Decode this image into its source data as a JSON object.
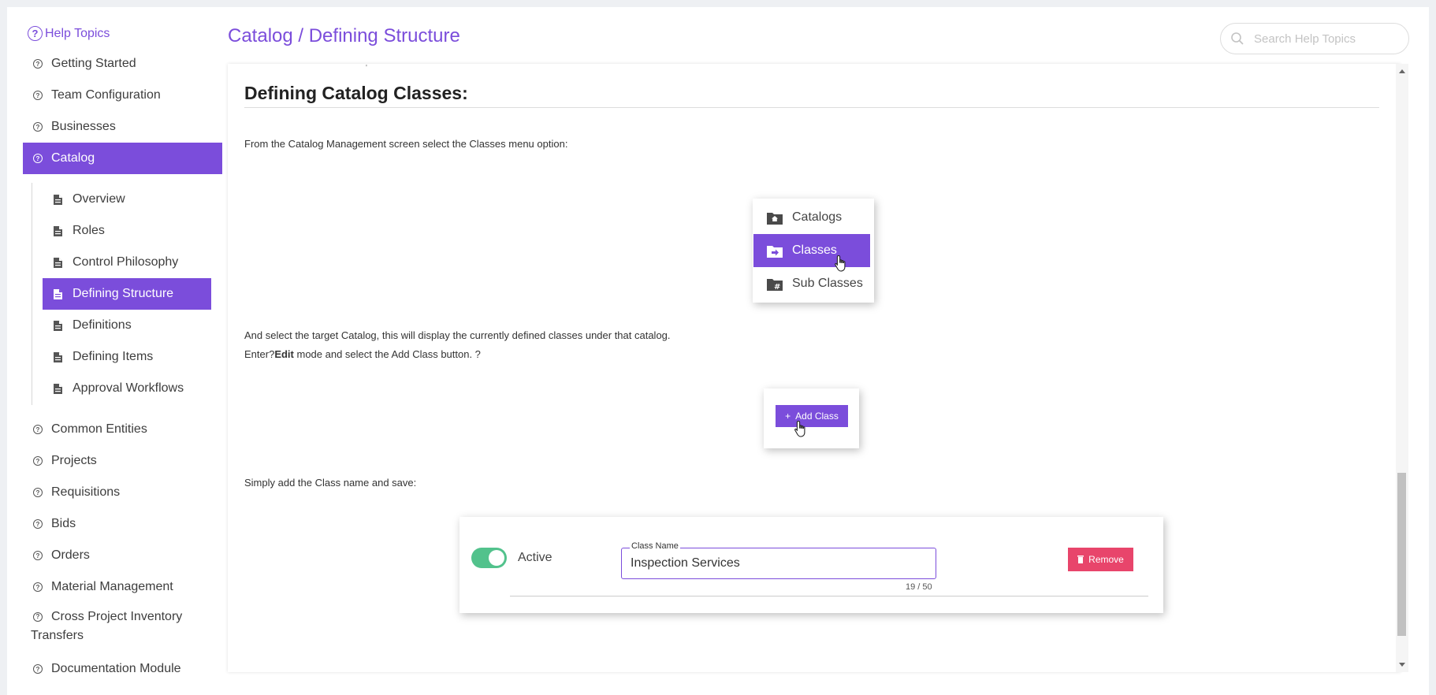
{
  "sidebar": {
    "help_title": "Help Topics",
    "items_top": [
      {
        "label": "Getting Started"
      },
      {
        "label": "Team Configuration"
      },
      {
        "label": "Businesses"
      },
      {
        "label": "Catalog"
      }
    ],
    "catalog_subitems": [
      {
        "label": "Overview"
      },
      {
        "label": "Roles"
      },
      {
        "label": "Control Philosophy"
      },
      {
        "label": "Defining Structure"
      },
      {
        "label": "Definitions"
      },
      {
        "label": "Defining Items"
      },
      {
        "label": "Approval Workflows"
      }
    ],
    "items_bottom": [
      {
        "label": "Common Entities"
      },
      {
        "label": "Projects"
      },
      {
        "label": "Requisitions"
      },
      {
        "label": "Bids"
      },
      {
        "label": "Orders"
      },
      {
        "label": "Material Management"
      },
      {
        "label": "Cross Project Inventory Transfers"
      },
      {
        "label": "Documentation Module"
      }
    ]
  },
  "header": {
    "title": "Catalog / Defining Structure",
    "search_placeholder": "Search Help Topics"
  },
  "content": {
    "heading": "Defining Catalog Classes:",
    "para1": "From the Catalog Management screen select the Classes menu option:",
    "para2": "And select the target Catalog, this will display the currently defined classes under that catalog.",
    "para3_pre": "Enter?",
    "para3_bold": "Edit",
    "para3_post": " mode and select the Add Class button. ?",
    "para4": "Simply add the Class name and save:",
    "menu": [
      {
        "label": "Catalogs",
        "icon": "folder-home-icon"
      },
      {
        "label": "Classes",
        "icon": "folder-arrow-icon"
      },
      {
        "label": "Sub Classes",
        "icon": "folder-hash-icon"
      }
    ],
    "add_class_label": "Add Class",
    "form": {
      "toggle_label": "Active",
      "field_legend": "Class Name",
      "field_value": "Inspection Services",
      "counter": "19 / 50",
      "remove_label": "Remove"
    }
  },
  "colors": {
    "accent": "#7b4ddb",
    "toggle_on": "#52c28c",
    "danger": "#e8456b"
  }
}
